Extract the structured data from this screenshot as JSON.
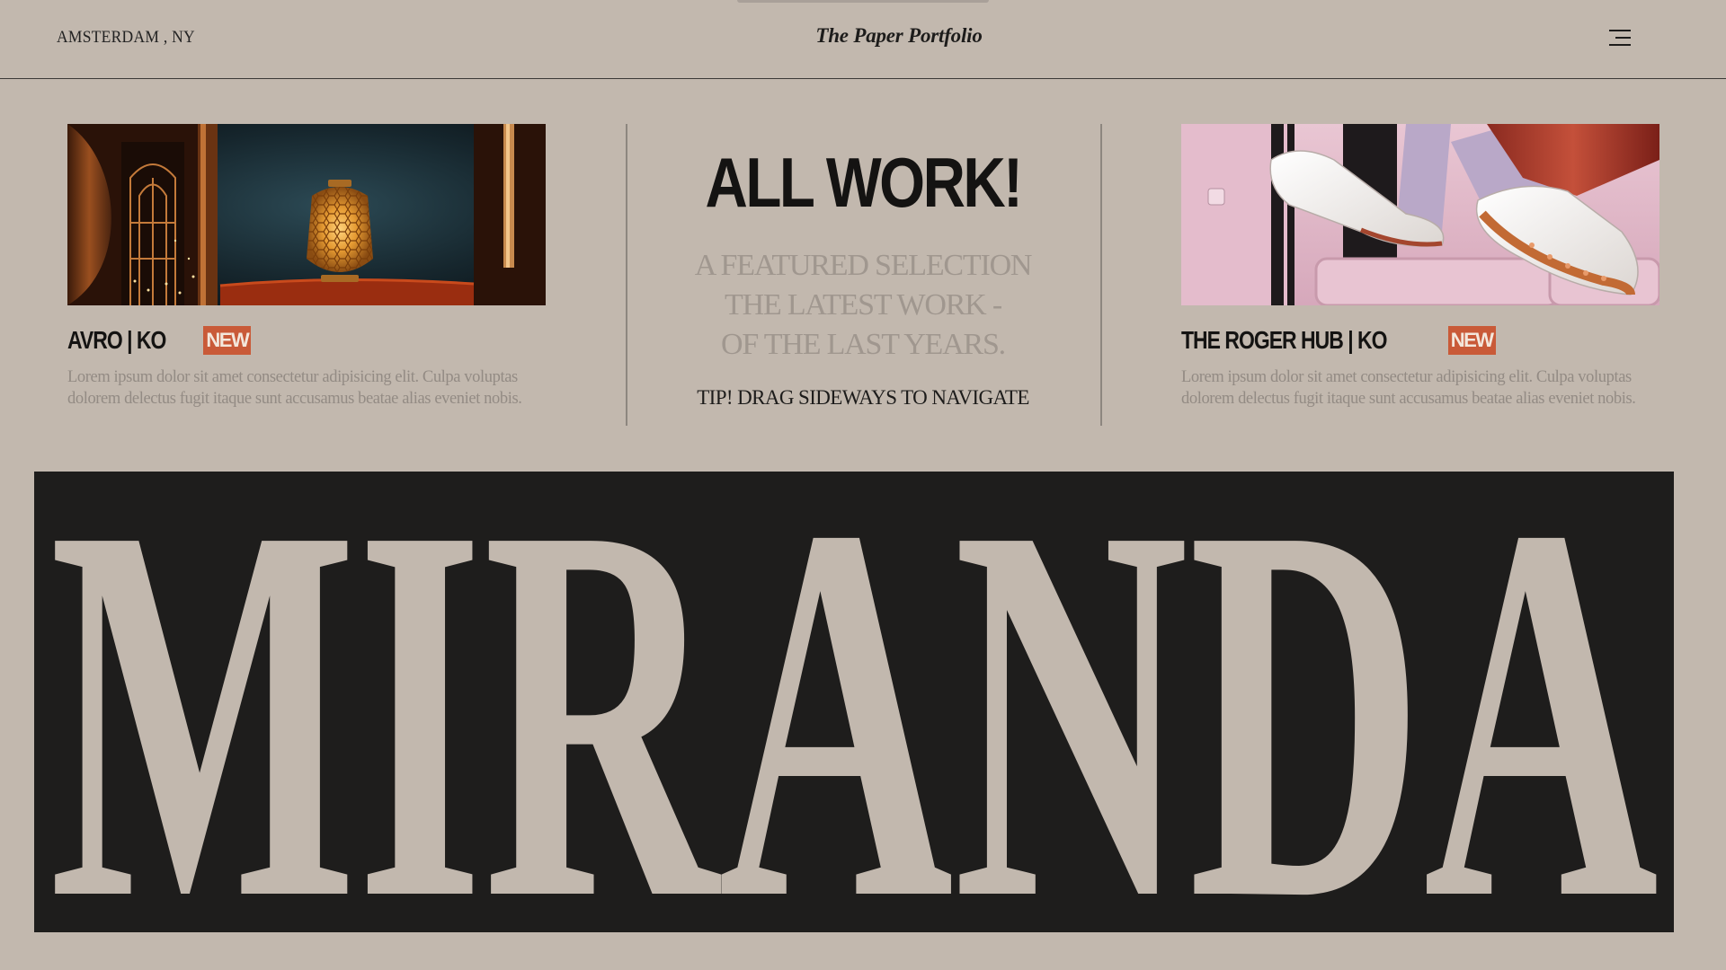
{
  "header": {
    "location": "AMSTERDAM , NY",
    "brand": "The Paper Portfolio",
    "menu_icon": "hamburger-menu-icon"
  },
  "intro": {
    "title": "ALL WORK!",
    "subtitle_lines": [
      "A FEATURED SELECTION",
      "THE LATEST WORK -",
      "OF THE LAST YEARS."
    ],
    "tip": "TIP! DRAG SIDEWAYS TO NAVIGATE"
  },
  "projects": [
    {
      "title": "AVRO | KO",
      "badge": "NEW",
      "description": "Lorem ipsum dolor sit amet consectetur adipisicing elit. Culpa voluptas dolorem delectus fugit itaque sunt accusamus beatae alias eveniet nobis."
    },
    {
      "title": "THE ROGER HUB | KO",
      "badge": "NEW",
      "description": "Lorem ipsum dolor sit amet consectetur adipisicing elit. Culpa voluptas dolorem delectus fugit itaque sunt accusamus beatae alias eveniet nobis."
    }
  ],
  "hero": {
    "word": "MIRANDA"
  },
  "colors": {
    "background": "#c2b8ae",
    "ink": "#1d1c1b",
    "accent": "#c95a38",
    "muted": "#938b84"
  }
}
